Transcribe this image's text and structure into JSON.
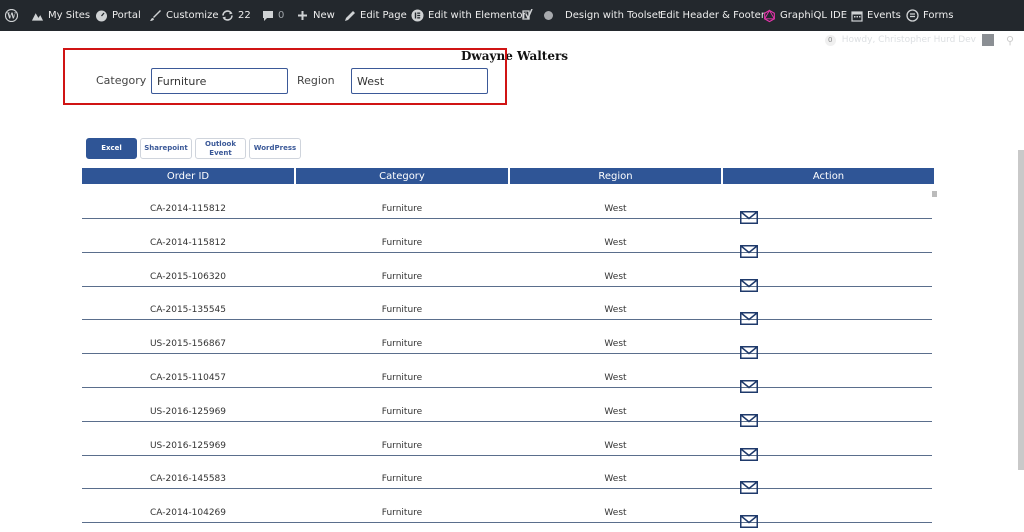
{
  "adminbar": {
    "items": [
      {
        "label": "",
        "icon": "wordpress-icon"
      },
      {
        "label": "My Sites",
        "icon": "my-sites-icon"
      },
      {
        "label": "Portal",
        "icon": "dashboard-icon"
      },
      {
        "label": "Customize",
        "icon": "brush-icon"
      },
      {
        "label": "22",
        "icon": "updates-icon"
      },
      {
        "label": "0",
        "icon": "comment-icon"
      },
      {
        "label": "New",
        "icon": "plus-icon"
      },
      {
        "label": "Edit Page",
        "icon": "pencil-icon"
      },
      {
        "label": "Edit with Elementor",
        "icon": "elementor-icon"
      },
      {
        "label": "",
        "icon": "yoast-icon"
      },
      {
        "label": "Design with Toolset",
        "icon": ""
      },
      {
        "label": "Edit Header & Footer",
        "icon": ""
      },
      {
        "label": "GraphiQL IDE",
        "icon": "graphiql-icon"
      },
      {
        "label": "Events",
        "icon": "calendar-icon"
      },
      {
        "label": "Forms",
        "icon": "forms-icon"
      }
    ],
    "howdy": "Howdy, Christopher Hurd Dev",
    "notif_count": "0"
  },
  "page": {
    "person_name": "Dwayne Walters",
    "filters": {
      "category_label": "Category",
      "category_value": "Furniture",
      "region_label": "Region",
      "region_value": "West"
    },
    "tabs": [
      {
        "label": "Excel",
        "active": true
      },
      {
        "label": "Sharepoint",
        "active": false
      },
      {
        "label": "Outlook Event",
        "active": false
      },
      {
        "label": "WordPress",
        "active": false
      }
    ]
  },
  "table": {
    "columns": [
      "Order ID",
      "Category",
      "Region",
      "Action"
    ],
    "rows": [
      {
        "order_id": "CA-2014-115812",
        "category": "Furniture",
        "region": "West"
      },
      {
        "order_id": "CA-2014-115812",
        "category": "Furniture",
        "region": "West"
      },
      {
        "order_id": "CA-2015-106320",
        "category": "Furniture",
        "region": "West"
      },
      {
        "order_id": "CA-2015-135545",
        "category": "Furniture",
        "region": "West"
      },
      {
        "order_id": "US-2015-156867",
        "category": "Furniture",
        "region": "West"
      },
      {
        "order_id": "CA-2015-110457",
        "category": "Furniture",
        "region": "West"
      },
      {
        "order_id": "US-2016-125969",
        "category": "Furniture",
        "region": "West"
      },
      {
        "order_id": "US-2016-125969",
        "category": "Furniture",
        "region": "West"
      },
      {
        "order_id": "CA-2016-145583",
        "category": "Furniture",
        "region": "West"
      },
      {
        "order_id": "CA-2014-104269",
        "category": "Furniture",
        "region": "West"
      }
    ],
    "action_icon": "mail-icon"
  },
  "colors": {
    "admin_bar": "#23282d",
    "accent": "#2f5596",
    "highlight_border": "#d01414"
  }
}
